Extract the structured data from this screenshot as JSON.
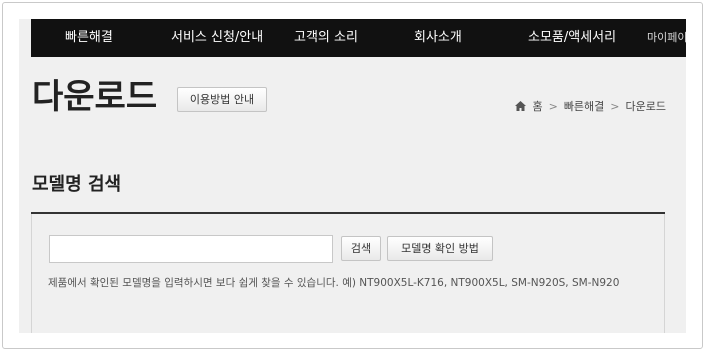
{
  "nav": {
    "items": [
      "빠른해결",
      "서비스 신청/안내",
      "고객의 소리",
      "회사소개",
      "소모품/액세서리",
      "마이페이지"
    ]
  },
  "header": {
    "title": "다운로드",
    "guide_button": "이용방법 안내"
  },
  "breadcrumb": {
    "items": [
      "홈",
      "빠른해결",
      "다운로드"
    ],
    "separator": ">"
  },
  "search": {
    "section_title": "모델명 검색",
    "input_value": "",
    "search_button": "검색",
    "howto_button": "모델명 확인 방법",
    "hint": "제품에서 확인된 모델명을 입력하시면 보다 쉽게 찾을 수 있습니다. 예) NT900X5L-K716, NT900X5L, SM-N920S, SM-N920"
  },
  "colors": {
    "nav_background": "#111111",
    "page_background": "#f0f0f0",
    "rule": "#333333"
  }
}
